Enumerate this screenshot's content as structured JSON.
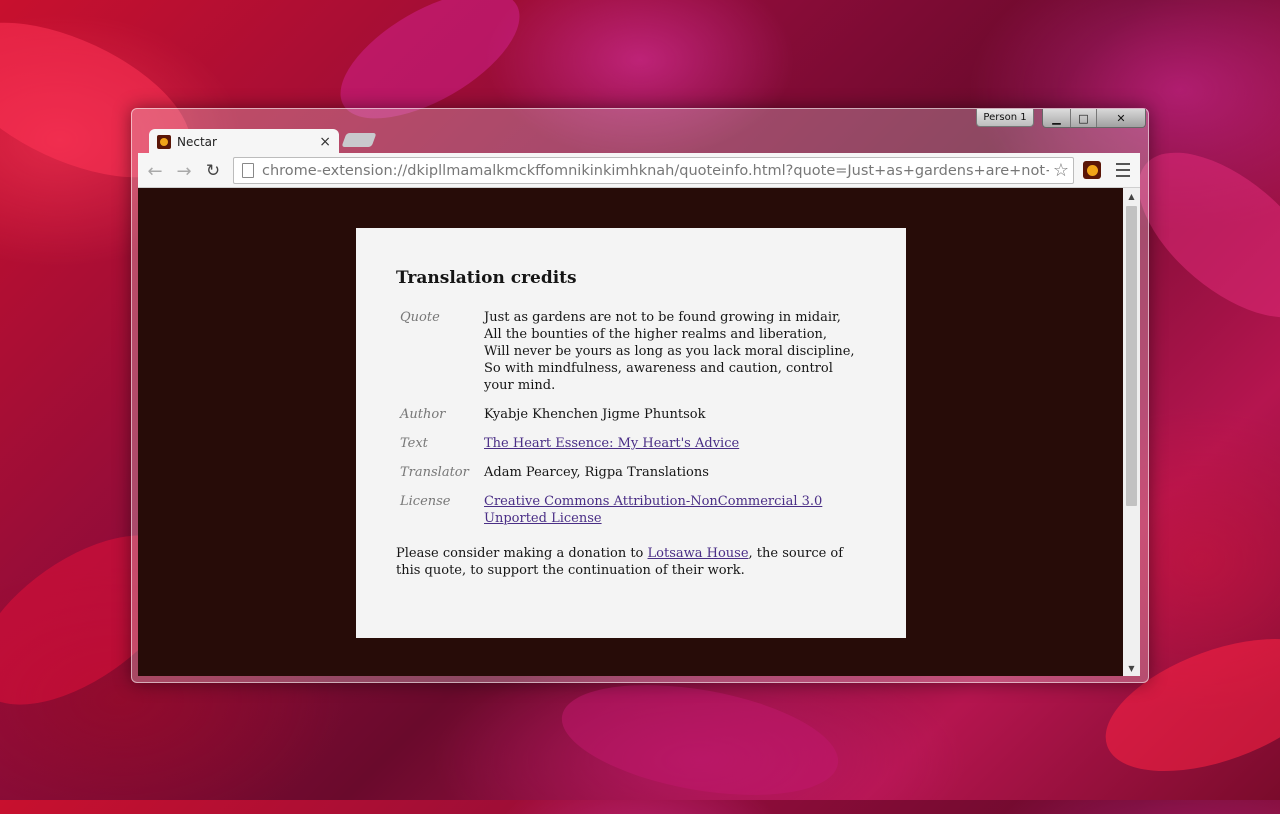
{
  "browser": {
    "tab_title": "Nectar",
    "tab_close": "×",
    "person_label": "Person 1",
    "window_controls": {
      "minimize": "▁",
      "maximize": "□",
      "close": "✕"
    },
    "nav": {
      "back": "←",
      "forward": "→",
      "reload": "↻"
    },
    "url": "chrome-extension://dkipllmamalkmckffomnikinkimhknah/quoteinfo.html?quote=Just+as+gardens+are+not+to+",
    "bookmark_star": "☆"
  },
  "colors": {
    "page_background": "#270c08",
    "card_background": "#f4f4f4",
    "link": "#4a2e86",
    "label": "#777777"
  },
  "page": {
    "heading": "Translation credits",
    "rows": {
      "quote": {
        "label": "Quote",
        "lines": [
          "Just as gardens are not to be found growing in midair,",
          "All the bounties of the higher realms and liberation,",
          "Will never be yours as long as you lack moral discipline,",
          "So with mindfulness, awareness and caution, control your mind."
        ]
      },
      "author": {
        "label": "Author",
        "value": "Kyabje Khenchen Jigme Phuntsok"
      },
      "text": {
        "label": "Text",
        "value": "The Heart Essence: My Heart's Advice"
      },
      "translator": {
        "label": "Translator",
        "value": "Adam Pearcey, Rigpa Translations"
      },
      "license": {
        "label": "License",
        "value": "Creative Commons Attribution-NonCommercial 3.0 Unported License"
      }
    },
    "donation": {
      "before": "Please consider making a donation to ",
      "link": "Lotsawa House",
      "after": ", the source of this quote, to support the continuation of their work."
    }
  }
}
